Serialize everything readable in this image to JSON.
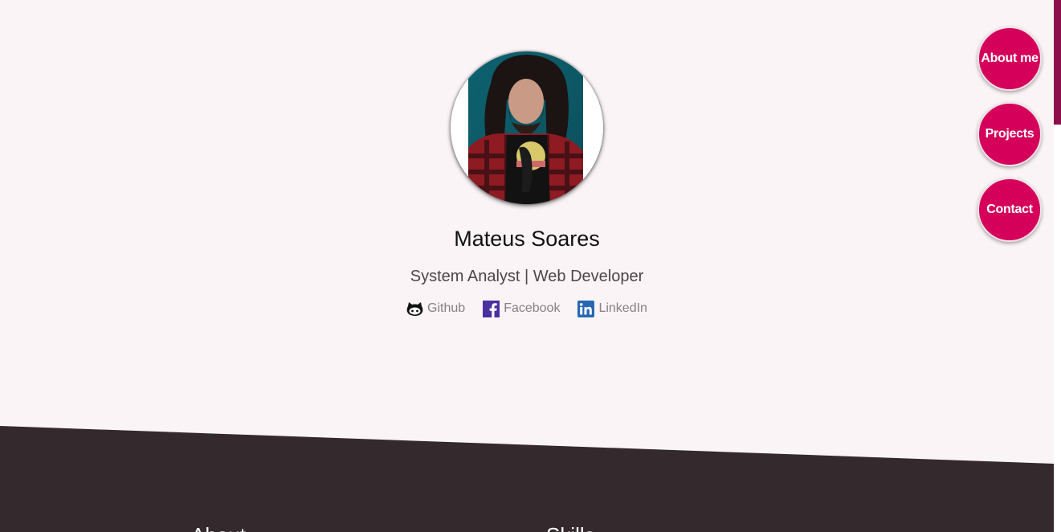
{
  "profile": {
    "name": "Mateus Soares",
    "role": "System Analyst | Web Developer"
  },
  "socials": [
    {
      "label": "Github",
      "icon": "github-icon"
    },
    {
      "label": "Facebook",
      "icon": "facebook-icon"
    },
    {
      "label": "LinkedIn",
      "icon": "linkedin-icon"
    }
  ],
  "nav": [
    {
      "label": "About me"
    },
    {
      "label": "Projects"
    },
    {
      "label": "Contact"
    }
  ],
  "sections": {
    "about_heading": "About",
    "skills_heading": "Skills"
  },
  "colors": {
    "accent": "#d4005a",
    "page_background": "#faf4f6",
    "dark_background": "#34292d",
    "scrollbar_thumb": "#8c0f4b",
    "facebook": "#4a2fa0",
    "linkedin": "#2867b2"
  }
}
